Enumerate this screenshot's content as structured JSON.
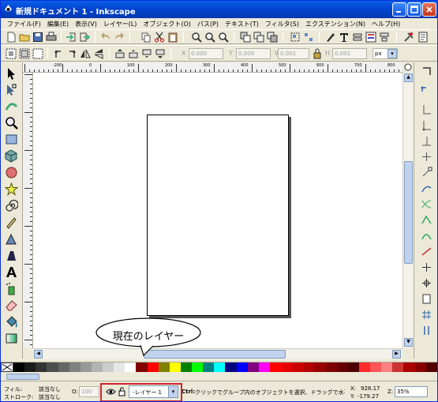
{
  "window": {
    "title": "新規ドキュメント 1 - Inkscape"
  },
  "menubar": {
    "items": [
      "ファイル(F)",
      "編集(E)",
      "表示(V)",
      "レイヤー(L)",
      "オブジェクト(O)",
      "パス(P)",
      "テキスト(T)",
      "フィルタ(S)",
      "エクステンション(N)",
      "ヘルプ(H)"
    ]
  },
  "tool_controls": {
    "x_label": "X",
    "x_value": "0.000",
    "y_label": "Y",
    "y_value": "0.000",
    "w_label": "W",
    "w_value": "0.001",
    "h_label": "H",
    "h_value": "0.001",
    "unit": "px"
  },
  "rulers": {
    "h_labels": [
      "-250",
      "-200",
      "-100",
      "0",
      "100",
      "200",
      "300",
      "400",
      "500",
      "600",
      "700",
      "800",
      "900",
      "1000",
      "1100"
    ],
    "v_labels": [
      "100",
      "1",
      "200",
      "3",
      "300",
      "4",
      "500",
      "6",
      "700",
      "8",
      "900",
      "1",
      "1100"
    ]
  },
  "status": {
    "fill_label": "フィル:",
    "fill_value": "該当なし",
    "stroke_label": "ストローク:",
    "stroke_value": "該当なし",
    "opacity_label": "O:",
    "opacity_value": "100",
    "layer_value": "-レイヤー 1",
    "message_bold": "Ctrl:",
    "message": "クリックでグループ内のオブジェクトを選択、ドラッグで水平/...",
    "x_label": "X:",
    "x_coord": "928.17",
    "y_label": "Y:",
    "y_coord": "-179.27",
    "zoom_label": "Z:",
    "zoom_value": "35%"
  },
  "annotation": {
    "callout_text": "現在のレイヤー",
    "highlight_color": "#d0262a"
  },
  "palette": {
    "colors": [
      "#000000",
      "#1a1a1a",
      "#333333",
      "#4d4d4d",
      "#666666",
      "#808080",
      "#999999",
      "#b3b3b3",
      "#cccccc",
      "#e6e6e6",
      "#ffffff",
      "#800000",
      "#ff0000",
      "#808000",
      "#ffff00",
      "#008000",
      "#00ff00",
      "#008080",
      "#00ffff",
      "#000080",
      "#0000ff",
      "#800080",
      "#ff00ff",
      "#ff0000",
      "#e50000",
      "#cc0000",
      "#b20000",
      "#990000",
      "#800000",
      "#660000",
      "#4d0000",
      "#ff2a2a",
      "#ff5555",
      "#ff8080",
      "#cc3333",
      "#aa0000",
      "#880000",
      "#550000"
    ]
  }
}
